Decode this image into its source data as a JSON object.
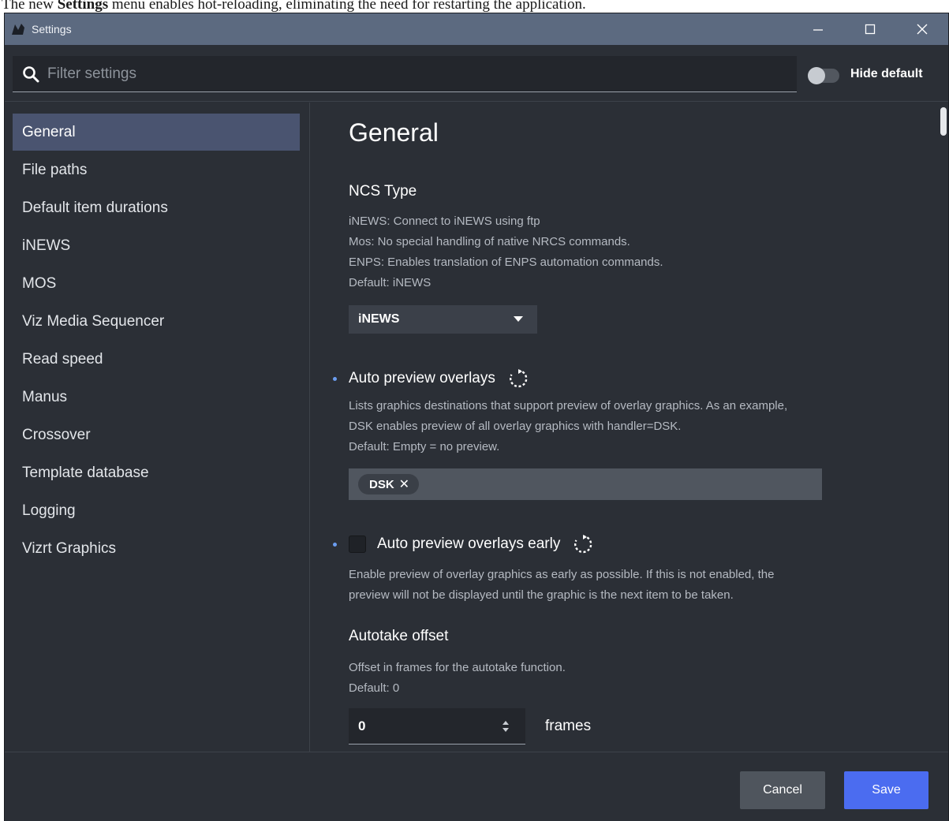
{
  "caption": {
    "prefix": "The new ",
    "bold": "Settings",
    "suffix": " menu enables hot-reloading, eliminating the need for restarting the application."
  },
  "window": {
    "title": "Settings",
    "app_icon": "vizrt-logo-icon",
    "controls": [
      "minimize-icon",
      "maximize-icon",
      "close-icon"
    ]
  },
  "filter": {
    "placeholder": "Filter settings",
    "value": "",
    "hide_default_label": "Hide default",
    "hide_default_on": false
  },
  "sidebar": {
    "items": [
      {
        "label": "General",
        "active": true
      },
      {
        "label": "File paths",
        "active": false
      },
      {
        "label": "Default item durations",
        "active": false
      },
      {
        "label": "iNEWS",
        "active": false
      },
      {
        "label": "MOS",
        "active": false
      },
      {
        "label": "Viz Media Sequencer",
        "active": false
      },
      {
        "label": "Read speed",
        "active": false
      },
      {
        "label": "Manus",
        "active": false
      },
      {
        "label": "Crossover",
        "active": false
      },
      {
        "label": "Template database",
        "active": false
      },
      {
        "label": "Logging",
        "active": false
      },
      {
        "label": "Vizrt Graphics",
        "active": false
      }
    ]
  },
  "main": {
    "title": "General",
    "ncs": {
      "title": "NCS Type",
      "desc": [
        "iNEWS: Connect to iNEWS using ftp",
        "Mos: No special handling of native NRCS commands.",
        "ENPS: Enables translation of ENPS automation commands.",
        "Default: iNEWS"
      ],
      "selected": "iNEWS"
    },
    "auto_preview": {
      "title": "Auto preview overlays",
      "desc": [
        "Lists graphics destinations that support preview of overlay graphics. As an example,",
        "DSK enables preview of all overlay graphics with handler=DSK.",
        "Default: Empty = no preview."
      ],
      "tags": [
        "DSK"
      ],
      "tag_remove_glyph": "✕"
    },
    "auto_preview_early": {
      "title": "Auto preview overlays early",
      "checked": false,
      "desc": [
        "Enable preview of overlay graphics as early as possible. If this is not enabled, the",
        "preview will not be displayed until the graphic is the next item to be taken."
      ]
    },
    "autotake": {
      "title": "Autotake offset",
      "desc": [
        "Offset in frames for the autotake function.",
        "Default: 0"
      ],
      "value": "0",
      "unit": "frames"
    }
  },
  "footer": {
    "cancel_label": "Cancel",
    "save_label": "Save"
  },
  "colors": {
    "window_bg": "#2b2f36",
    "titlebar": "#5c6a80",
    "active_nav": "#4a5470",
    "accent_save": "#4b6cf0",
    "modified_dot": "#6b9df0"
  }
}
